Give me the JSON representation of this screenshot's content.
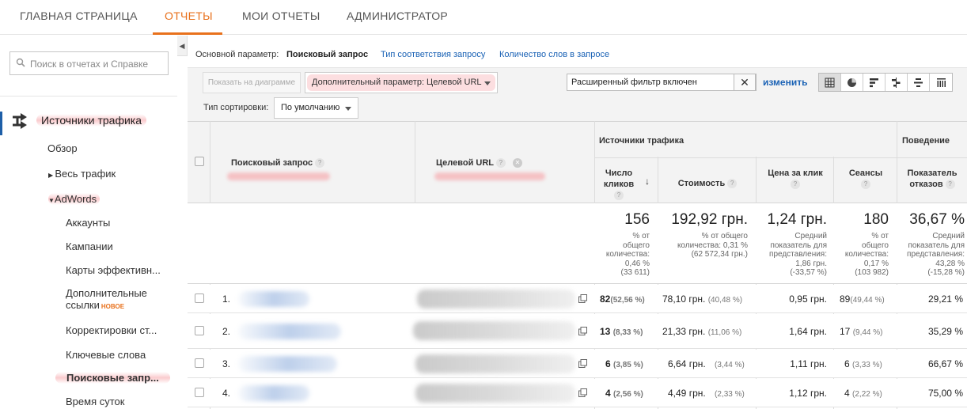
{
  "topnav": {
    "items": [
      "ГЛАВНАЯ СТРАНИЦА",
      "ОТЧЕТЫ",
      "МОИ ОТЧЕТЫ",
      "АДМИНИСТРАТОР"
    ],
    "active": "ОТЧЕТЫ",
    "accent": "#e8711c"
  },
  "sidebar": {
    "search_placeholder": "Поиск в отчетах и Справке",
    "section_title": "Источники трафика",
    "section_icon": "traffic-sources-icon",
    "items": {
      "overview": "Обзор",
      "all_traffic": "Весь трафик",
      "adwords": "AdWords",
      "accounts": "Аккаунты",
      "campaigns": "Кампании",
      "heatmaps": "Карты эффективн...",
      "sitelinks_1": "Дополнительные",
      "sitelinks_2": "ссылки",
      "sitelinks_badge": "НОВОЕ",
      "adjustments": "Корректировки ст...",
      "keywords": "Ключевые слова",
      "queries": "Поисковые запр...",
      "hour_of_day": "Время суток"
    }
  },
  "report": {
    "primary_dim_label": "Основной параметр:",
    "primary_dim_selected": "Поисковый запрос",
    "primary_dim_link1": "Тип соответствия запросу",
    "primary_dim_link2": "Количество слов в запросе",
    "plot_button": "Показать на диаграмме",
    "secondary_dim": "Дополнительный параметр: Целевой URL",
    "filter_text": "Расширенный фильтр включен",
    "filter_clear": "✕",
    "change_link": "изменить",
    "sort_label": "Тип сортировки:",
    "sort_value": "По умолчанию",
    "view_icons": [
      "table-view-icon",
      "pie-view-icon",
      "performance-view-icon",
      "comparison-view-icon",
      "term-cloud-icon",
      "pivot-view-icon"
    ]
  },
  "table": {
    "col_query": "Поисковый запрос",
    "col_url": "Целевой URL",
    "group_traffic": "Источники трафика",
    "group_behavior": "Поведение",
    "col_clicks_1": "Число",
    "col_clicks_2": "кликов",
    "col_cost": "Стоимость",
    "col_cpc": "Цена за клик",
    "col_sessions": "Сеансы",
    "col_bounce_1": "Показатель",
    "col_bounce_2": "отказов",
    "totals": {
      "clicks": "156",
      "clicks_sub": [
        "% от",
        "общего",
        "количества:",
        "0,46 %",
        "(33 611)"
      ],
      "cost": "192,92 грн.",
      "cost_sub": [
        "% от общего",
        "количества: 0,31 %",
        "(62 572,34 грн.)"
      ],
      "cpc": "1,24 грн.",
      "cpc_sub": [
        "Средний",
        "показатель для",
        "представления:",
        "1,86 грн.",
        "(-33,57 %)"
      ],
      "sessions": "180",
      "sessions_sub": [
        "% от",
        "общего",
        "количества:",
        "0,17 %",
        "(103 982)"
      ],
      "bounce": "36,67 %",
      "bounce_sub": [
        "Средний",
        "показатель для",
        "представления:",
        "43,28 %",
        "(-15,28 %)"
      ]
    },
    "rows": [
      {
        "n": "1.",
        "clicks": "82",
        "clicks_p": "(52,56 %)",
        "cost": "78,10 грн.",
        "cost_p": "(40,48 %)",
        "cpc": "0,95 грн.",
        "sessions": "89",
        "sessions_p": "(49,44 %)",
        "bounce": "29,21 %"
      },
      {
        "n": "2.",
        "clicks": "13",
        "clicks_p": "(8,33 %)",
        "cost": "21,33 грн.",
        "cost_p": "(11,06 %)",
        "cpc": "1,64 грн.",
        "sessions": "17",
        "sessions_p": "(9,44 %)",
        "bounce": "35,29 %"
      },
      {
        "n": "3.",
        "clicks": "6",
        "clicks_p": "(3,85 %)",
        "cost": "6,64 грн.",
        "cost_p": "(3,44 %)",
        "cpc": "1,11 грн.",
        "sessions": "6",
        "sessions_p": "(3,33 %)",
        "bounce": "66,67 %"
      },
      {
        "n": "4.",
        "clicks": "4",
        "clicks_p": "(2,56 %)",
        "cost": "4,49 грн.",
        "cost_p": "(2,33 %)",
        "cpc": "1,12 грн.",
        "sessions": "4",
        "sessions_p": "(2,22 %)",
        "bounce": "75,00 %"
      }
    ]
  }
}
